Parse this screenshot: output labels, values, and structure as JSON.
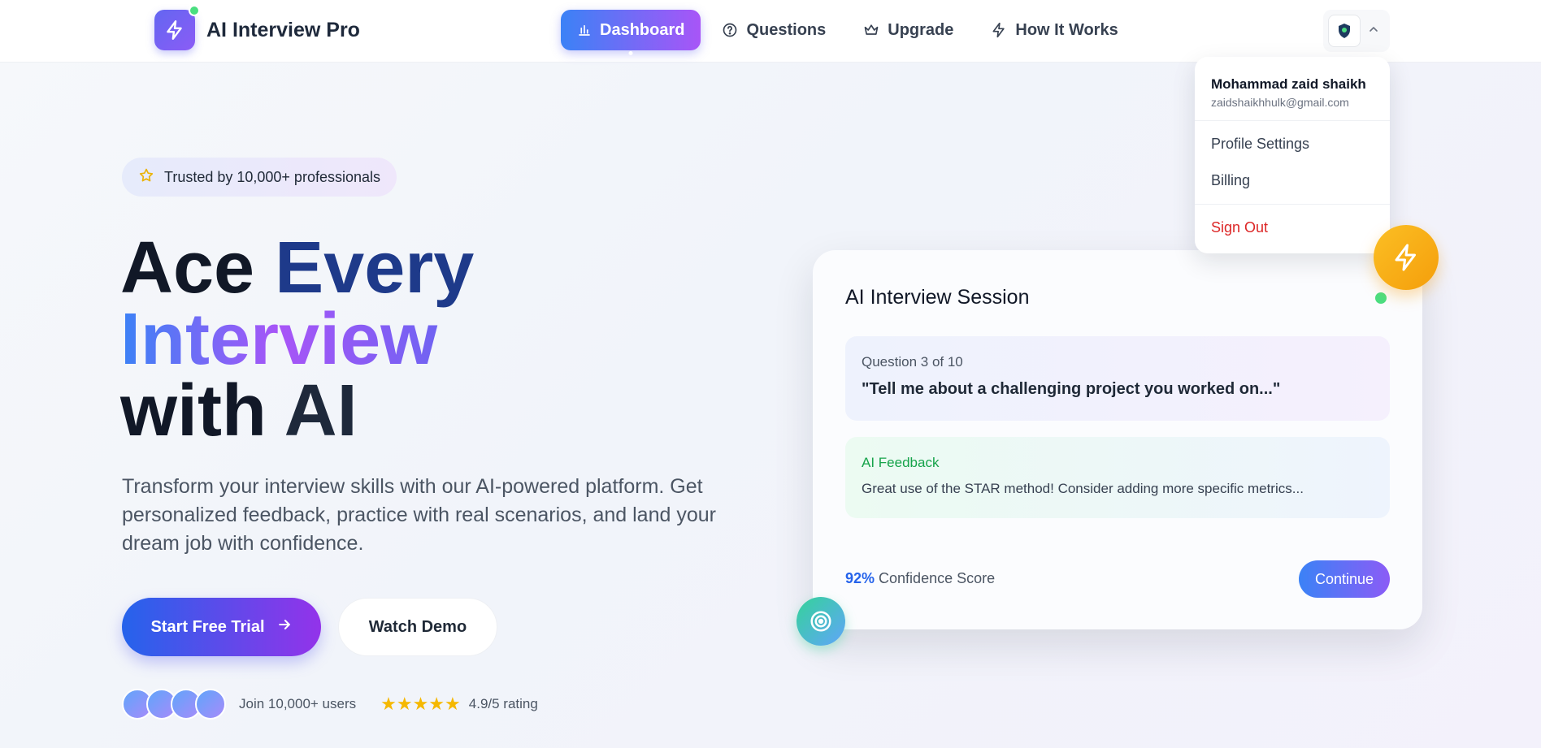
{
  "header": {
    "brand": "AI Interview Pro",
    "nav": [
      {
        "label": "Dashboard",
        "icon": "bar-chart-icon",
        "active": true
      },
      {
        "label": "Questions",
        "icon": "help-circle-icon"
      },
      {
        "label": "Upgrade",
        "icon": "crown-icon"
      },
      {
        "label": "How It Works",
        "icon": "zap-icon"
      }
    ]
  },
  "user_menu": {
    "name": "Mohammad zaid shaikh",
    "email": "zaidshaikhhulk@gmail.com",
    "items": [
      "Profile Settings",
      "Billing"
    ],
    "sign_out": "Sign Out"
  },
  "hero": {
    "badge": "Trusted by 10,000+ professionals",
    "headline_line1a": "Ace ",
    "headline_line1b": "Every",
    "headline_line2": "Interview",
    "headline_line3a": "with ",
    "headline_line3b": "AI",
    "subtitle": "Transform your interview skills with our AI-powered platform. Get personalized feedback, practice with real scenarios, and land your dream job with confidence.",
    "cta_primary": "Start Free Trial",
    "cta_secondary": "Watch Demo",
    "users_text": "Join 10,000+ users",
    "rating_stars": "★★★★★",
    "rating_text": "4.9/5 rating"
  },
  "session_card": {
    "title": "AI Interview Session",
    "question_count": "Question 3 of 10",
    "question_text": "\"Tell me about a challenging project you worked on...\"",
    "feedback_label": "AI Feedback",
    "feedback_text": "Great use of the STAR method! Consider adding more specific metrics...",
    "score_value": "92%",
    "score_label": " Confidence Score",
    "continue": "Continue"
  },
  "colors": {
    "primary": "#3b82f6",
    "accent": "#a855f7",
    "success": "#16a34a",
    "danger": "#dc2626",
    "star": "#f5b800"
  }
}
